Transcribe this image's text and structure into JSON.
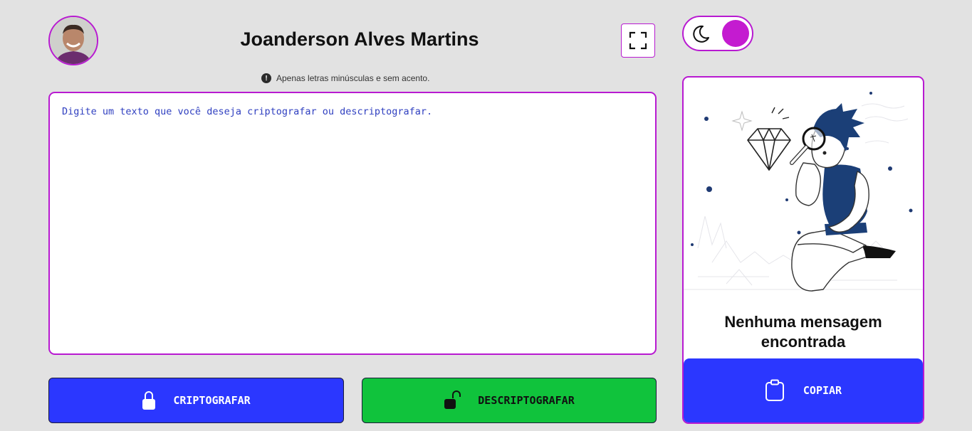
{
  "header": {
    "name": "Joanderson Alves Martins",
    "avatar_icon": "user-photo",
    "expand_icon": "fullscreen-icon"
  },
  "hint": {
    "icon": "exclamation-circle-icon",
    "text": "Apenas letras minúsculas e sem acento."
  },
  "input": {
    "placeholder": "Digite um texto que você deseja criptografar ou descriptografar.",
    "value": ""
  },
  "actions": {
    "encrypt_label": "CRIPTOGRAFAR",
    "encrypt_icon": "lock-icon",
    "decrypt_label": "DESCRIPTOGRAFAR",
    "decrypt_icon": "unlock-icon"
  },
  "theme_toggle": {
    "icon": "moon-icon",
    "state": "on"
  },
  "output": {
    "message": "Nenhuma mensagem encontrada",
    "copy_label": "COPIAR",
    "copy_icon": "clipboard-icon"
  },
  "colors": {
    "accent": "#b81ad1",
    "primary_button": "#2b37ff",
    "decrypt_button": "#10c33c",
    "background": "#e2e2e2",
    "toggle_knob": "#c41bd0"
  }
}
